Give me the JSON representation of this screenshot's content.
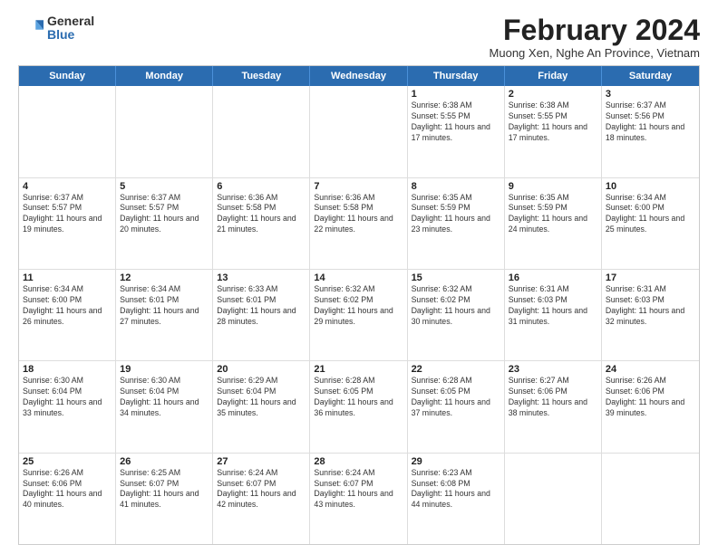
{
  "logo": {
    "general": "General",
    "blue": "Blue"
  },
  "title": "February 2024",
  "subtitle": "Muong Xen, Nghe An Province, Vietnam",
  "days_of_week": [
    "Sunday",
    "Monday",
    "Tuesday",
    "Wednesday",
    "Thursday",
    "Friday",
    "Saturday"
  ],
  "weeks": [
    [
      {
        "day": "",
        "info": ""
      },
      {
        "day": "",
        "info": ""
      },
      {
        "day": "",
        "info": ""
      },
      {
        "day": "",
        "info": ""
      },
      {
        "day": "1",
        "info": "Sunrise: 6:38 AM\nSunset: 5:55 PM\nDaylight: 11 hours and 17 minutes."
      },
      {
        "day": "2",
        "info": "Sunrise: 6:38 AM\nSunset: 5:55 PM\nDaylight: 11 hours and 17 minutes."
      },
      {
        "day": "3",
        "info": "Sunrise: 6:37 AM\nSunset: 5:56 PM\nDaylight: 11 hours and 18 minutes."
      }
    ],
    [
      {
        "day": "4",
        "info": "Sunrise: 6:37 AM\nSunset: 5:57 PM\nDaylight: 11 hours and 19 minutes."
      },
      {
        "day": "5",
        "info": "Sunrise: 6:37 AM\nSunset: 5:57 PM\nDaylight: 11 hours and 20 minutes."
      },
      {
        "day": "6",
        "info": "Sunrise: 6:36 AM\nSunset: 5:58 PM\nDaylight: 11 hours and 21 minutes."
      },
      {
        "day": "7",
        "info": "Sunrise: 6:36 AM\nSunset: 5:58 PM\nDaylight: 11 hours and 22 minutes."
      },
      {
        "day": "8",
        "info": "Sunrise: 6:35 AM\nSunset: 5:59 PM\nDaylight: 11 hours and 23 minutes."
      },
      {
        "day": "9",
        "info": "Sunrise: 6:35 AM\nSunset: 5:59 PM\nDaylight: 11 hours and 24 minutes."
      },
      {
        "day": "10",
        "info": "Sunrise: 6:34 AM\nSunset: 6:00 PM\nDaylight: 11 hours and 25 minutes."
      }
    ],
    [
      {
        "day": "11",
        "info": "Sunrise: 6:34 AM\nSunset: 6:00 PM\nDaylight: 11 hours and 26 minutes."
      },
      {
        "day": "12",
        "info": "Sunrise: 6:34 AM\nSunset: 6:01 PM\nDaylight: 11 hours and 27 minutes."
      },
      {
        "day": "13",
        "info": "Sunrise: 6:33 AM\nSunset: 6:01 PM\nDaylight: 11 hours and 28 minutes."
      },
      {
        "day": "14",
        "info": "Sunrise: 6:32 AM\nSunset: 6:02 PM\nDaylight: 11 hours and 29 minutes."
      },
      {
        "day": "15",
        "info": "Sunrise: 6:32 AM\nSunset: 6:02 PM\nDaylight: 11 hours and 30 minutes."
      },
      {
        "day": "16",
        "info": "Sunrise: 6:31 AM\nSunset: 6:03 PM\nDaylight: 11 hours and 31 minutes."
      },
      {
        "day": "17",
        "info": "Sunrise: 6:31 AM\nSunset: 6:03 PM\nDaylight: 11 hours and 32 minutes."
      }
    ],
    [
      {
        "day": "18",
        "info": "Sunrise: 6:30 AM\nSunset: 6:04 PM\nDaylight: 11 hours and 33 minutes."
      },
      {
        "day": "19",
        "info": "Sunrise: 6:30 AM\nSunset: 6:04 PM\nDaylight: 11 hours and 34 minutes."
      },
      {
        "day": "20",
        "info": "Sunrise: 6:29 AM\nSunset: 6:04 PM\nDaylight: 11 hours and 35 minutes."
      },
      {
        "day": "21",
        "info": "Sunrise: 6:28 AM\nSunset: 6:05 PM\nDaylight: 11 hours and 36 minutes."
      },
      {
        "day": "22",
        "info": "Sunrise: 6:28 AM\nSunset: 6:05 PM\nDaylight: 11 hours and 37 minutes."
      },
      {
        "day": "23",
        "info": "Sunrise: 6:27 AM\nSunset: 6:06 PM\nDaylight: 11 hours and 38 minutes."
      },
      {
        "day": "24",
        "info": "Sunrise: 6:26 AM\nSunset: 6:06 PM\nDaylight: 11 hours and 39 minutes."
      }
    ],
    [
      {
        "day": "25",
        "info": "Sunrise: 6:26 AM\nSunset: 6:06 PM\nDaylight: 11 hours and 40 minutes."
      },
      {
        "day": "26",
        "info": "Sunrise: 6:25 AM\nSunset: 6:07 PM\nDaylight: 11 hours and 41 minutes."
      },
      {
        "day": "27",
        "info": "Sunrise: 6:24 AM\nSunset: 6:07 PM\nDaylight: 11 hours and 42 minutes."
      },
      {
        "day": "28",
        "info": "Sunrise: 6:24 AM\nSunset: 6:07 PM\nDaylight: 11 hours and 43 minutes."
      },
      {
        "day": "29",
        "info": "Sunrise: 6:23 AM\nSunset: 6:08 PM\nDaylight: 11 hours and 44 minutes."
      },
      {
        "day": "",
        "info": ""
      },
      {
        "day": "",
        "info": ""
      }
    ]
  ]
}
